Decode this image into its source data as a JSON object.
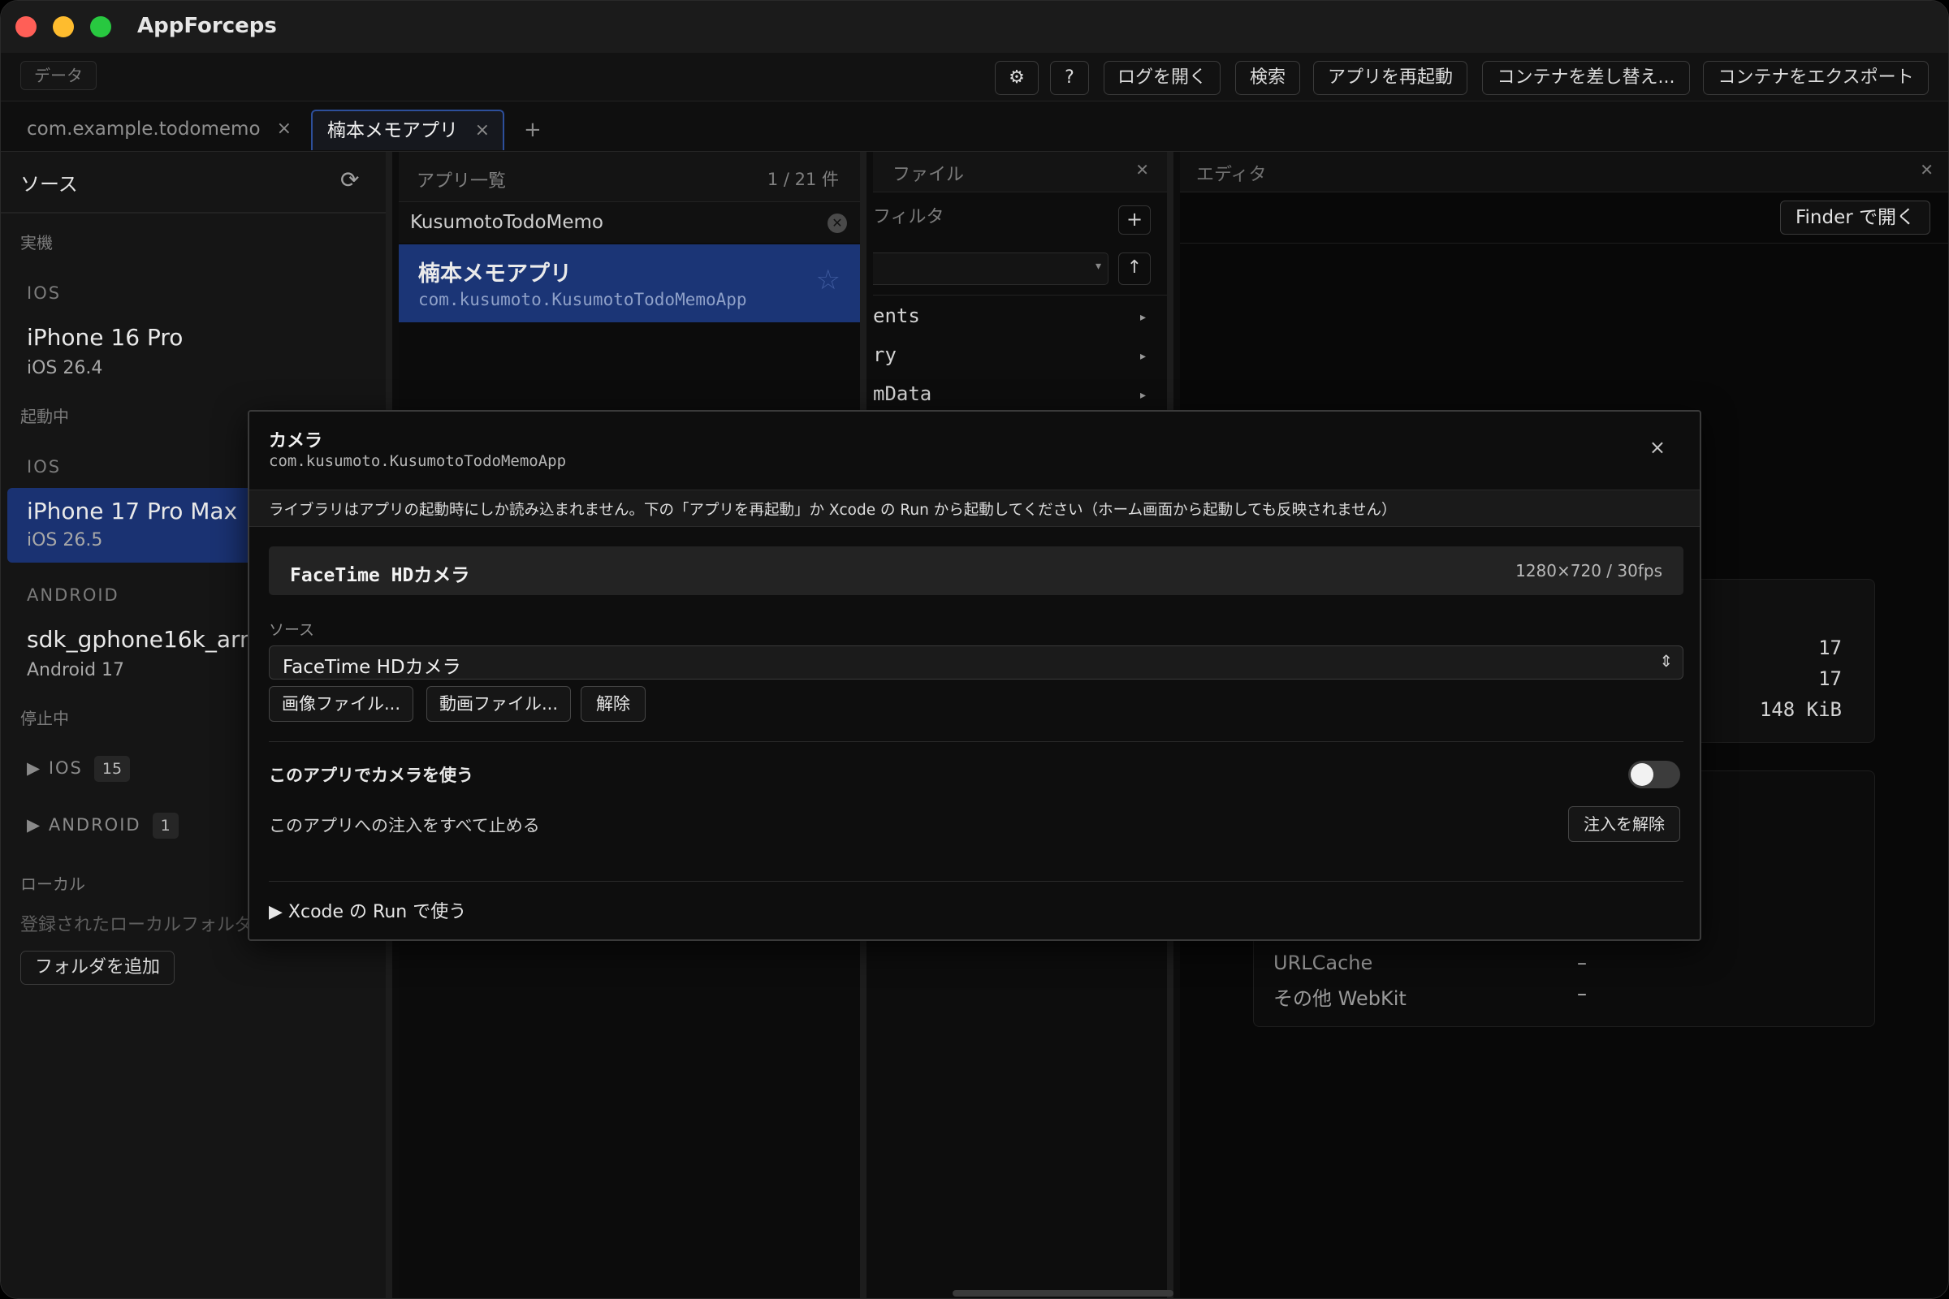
{
  "window": {
    "app_title": "AppForceps"
  },
  "toolbar": {
    "left_label": "データ",
    "settings_icon": "gear-icon",
    "help_label": "?",
    "open_log": "ログを開く",
    "search": "検索",
    "restart_app": "アプリを再起動",
    "replace_container": "コンテナを差し替え...",
    "export_container": "コンテナをエクスポート"
  },
  "tabs": [
    {
      "label": "com.example.todomemo",
      "close": "×"
    },
    {
      "label": "楠本メモアプリ",
      "close": "×"
    }
  ],
  "tab_add": "+",
  "sidebar": {
    "title": "ソース",
    "sections": {
      "real_device": "実機",
      "running": "起動中",
      "stopped": "停止中",
      "local": "ローカル"
    },
    "platform_ios": "IOS",
    "platform_android": "ANDROID",
    "devices": [
      {
        "name": "iPhone 16 Pro",
        "os": "iOS 26.4"
      },
      {
        "name": "iPhone 17 Pro Max",
        "os": "iOS 26.5"
      },
      {
        "name": "sdk_gphone16k_arm",
        "os": "Android 17"
      }
    ],
    "stopped_groups": [
      {
        "label": "IOS",
        "count": "15"
      },
      {
        "label": "ANDROID",
        "count": "1"
      }
    ],
    "local_empty": "登録されたローカルフォルダ",
    "add_folder": "フォルダを追加"
  },
  "app_list": {
    "title": "アプリ一覧",
    "count": "1 / 21 件",
    "search_value": "KusumotoTodoMemo",
    "items": [
      {
        "name": "楠本メモアプリ",
        "bundle_id": "com.kusumoto.KusumotoTodoMemoApp"
      }
    ]
  },
  "files": {
    "title": "ファイル",
    "filter_label": "フィルタ",
    "rows": [
      "ents",
      "ry",
      "mData"
    ]
  },
  "editor": {
    "title": "エディタ",
    "open_finder": "Finder で開く",
    "stats": [
      "17",
      "17",
      "148 KiB"
    ],
    "cache_rows": [
      {
        "label": "URLCache",
        "value": "–"
      },
      {
        "label": "その他 WebKit",
        "value": "–"
      }
    ]
  },
  "modal": {
    "title": "カメラ",
    "subtitle": "com.kusumoto.KusumotoTodoMemoApp",
    "close": "×",
    "notice": "ライブラリはアプリの起動時にしか読み込まれません。下の「アプリを再起動」か Xcode の Run から起動してください（ホーム画面から起動しても反映されません）",
    "camera_name": "FaceTime HDカメラ",
    "camera_res": "1280×720 / 30fps",
    "source_label": "ソース",
    "source_value": "FaceTime HDカメラ",
    "btn_image": "画像ファイル...",
    "btn_video": "動画ファイル...",
    "btn_clear": "解除",
    "toggle_label": "このアプリでカメラを使う",
    "toggle_on": false,
    "stop_label": "このアプリへの注入をすべて止める",
    "stop_button": "注入を解除",
    "xcode_label": "▶ Xcode の Run で使う"
  }
}
